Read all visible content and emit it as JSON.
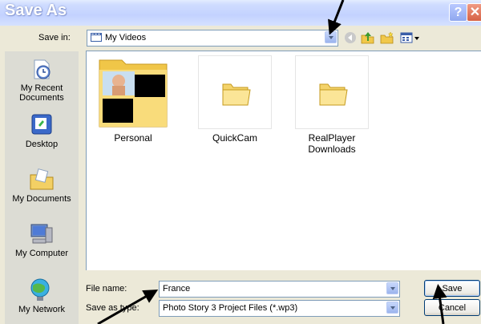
{
  "window": {
    "title": "Save As",
    "help_button": "?",
    "close_button": "✕"
  },
  "savein": {
    "label": "Save in:",
    "value": "My Videos"
  },
  "places": [
    {
      "label": "My Recent\nDocuments",
      "icon": "recent-documents-icon"
    },
    {
      "label": "Desktop",
      "icon": "desktop-icon"
    },
    {
      "label": "My Documents",
      "icon": "my-documents-icon"
    },
    {
      "label": "My Computer",
      "icon": "my-computer-icon"
    },
    {
      "label": "My Network",
      "icon": "my-network-icon"
    }
  ],
  "files": [
    {
      "name": "Personal",
      "icon": "photo-folder-icon"
    },
    {
      "name": "QuickCam",
      "icon": "folder-icon"
    },
    {
      "name": "RealPlayer\nDownloads",
      "icon": "folder-icon"
    }
  ],
  "filename": {
    "label": "File name:",
    "value": "France"
  },
  "filetype": {
    "label": "Save as type:",
    "value": "Photo Story 3 Project Files (*.wp3)"
  },
  "buttons": {
    "save": "Save",
    "cancel": "Cancel"
  },
  "colors": {
    "title_bar": "#cfdcff",
    "dialog_bg": "#ece9d8",
    "places_bg": "#dcdcd4",
    "folder_yellow": "#f5d773"
  }
}
